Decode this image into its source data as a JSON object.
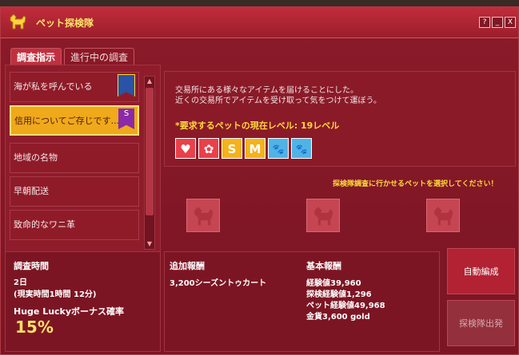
{
  "window": {
    "title": "ペット探検隊",
    "controls": [
      "?",
      "_",
      "X"
    ]
  },
  "tabs": [
    {
      "label": "調査指示",
      "active": true
    },
    {
      "label": "進行中の調査",
      "active": false
    }
  ],
  "missions": [
    {
      "label": "海が私を呼んでいる",
      "badge": "blue",
      "selected": false
    },
    {
      "label": "信用についてご存じです...",
      "badge": "S",
      "selected": true
    },
    {
      "label": "地域の名物",
      "selected": false
    },
    {
      "label": "早朝配送",
      "selected": false
    },
    {
      "label": "致命的なワニ革",
      "selected": false
    }
  ],
  "description": {
    "line1": "交易所にある様々なアイテムを届けることにした。",
    "line2": "近くの交易所でアイテムを受け取って気をつけて運ぼう。"
  },
  "requirement": {
    "title": "*要求するペットの現在レベル: 19レベル",
    "icons": [
      {
        "name": "heart-icon",
        "glyph": "♥",
        "color": "#e9404a"
      },
      {
        "name": "gear-icon",
        "glyph": "✿",
        "color": "#e9404a"
      },
      {
        "name": "size-s-icon",
        "glyph": "S",
        "color": "#f4b21c"
      },
      {
        "name": "size-m-icon",
        "glyph": "M",
        "color": "#f4b21c"
      },
      {
        "name": "paw-icon",
        "glyph": "🐾",
        "color": "#4fb3e6"
      },
      {
        "name": "paw-icon",
        "glyph": "🐾",
        "color": "#4fb3e6"
      }
    ]
  },
  "select_message": "探検隊調査に行かせるペットを選択してください！",
  "survey_time": {
    "heading": "調査時間",
    "days": "2日",
    "real": "(現実時間1時間 12分)",
    "bonus_label": "Huge Luckyボーナス確率",
    "bonus_value": "15%"
  },
  "extra_reward": {
    "heading": "追加報酬",
    "item": "3,200シーズントゥカート"
  },
  "base_reward": {
    "heading": "基本報酬",
    "lines": [
      "経験値39,960",
      "探検経験値1,296",
      "ペット経験値49,968",
      "金貨3,600 gold"
    ]
  },
  "buttons": {
    "auto": "自動編成",
    "depart": "探検隊出発"
  },
  "colors": {
    "accent_gold": "#ffd93a",
    "window_red": "#8b1a28"
  }
}
